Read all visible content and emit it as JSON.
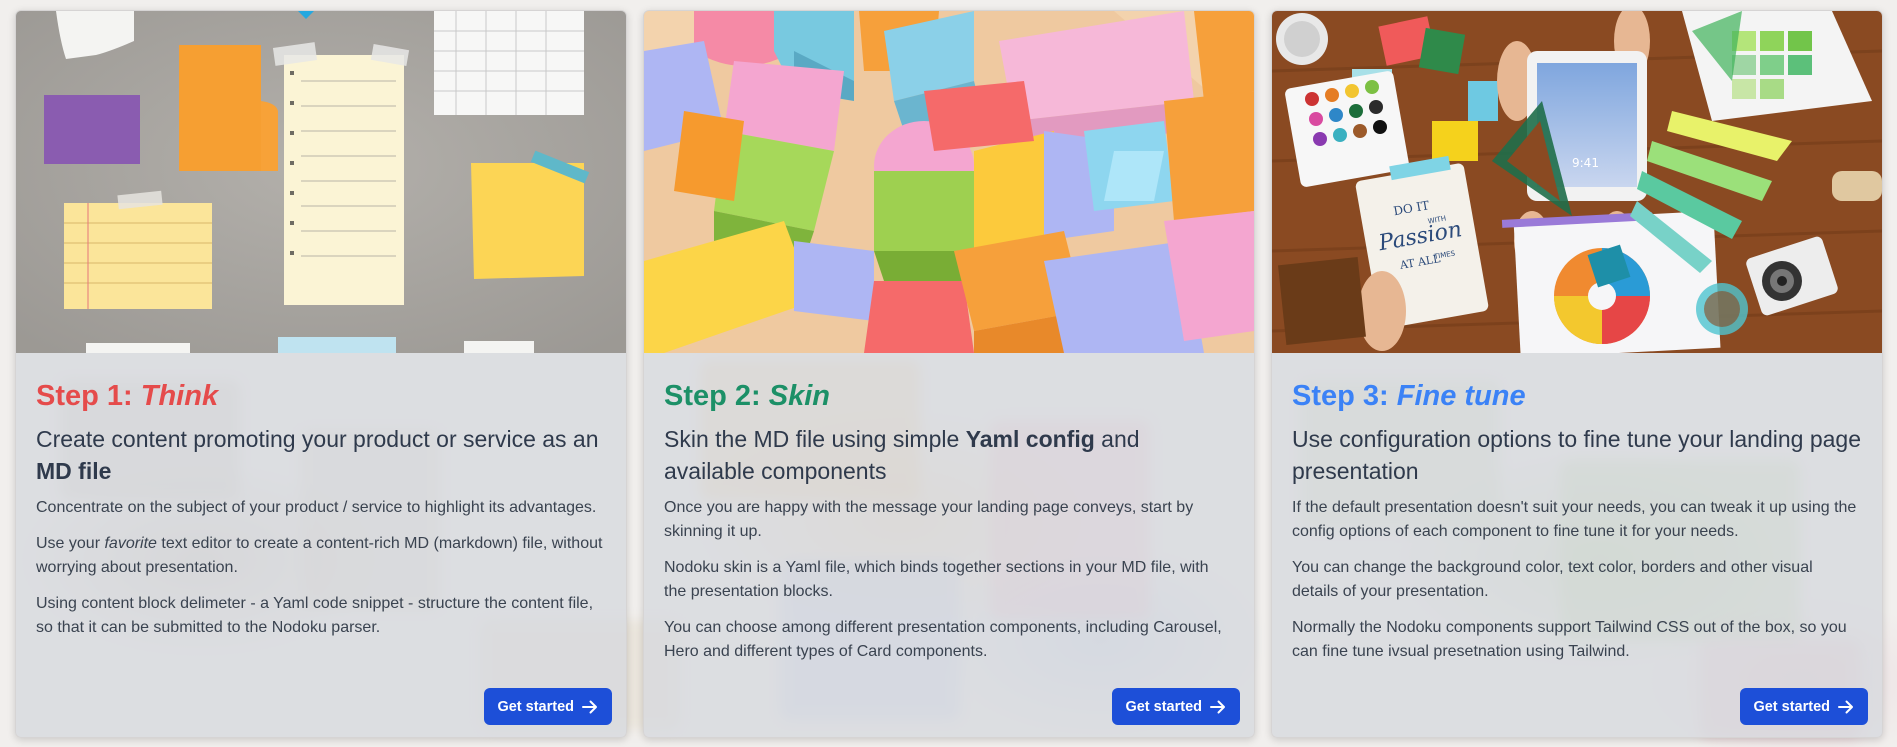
{
  "cards": [
    {
      "step_prefix": "Step 1: ",
      "step_word": "Think",
      "color": "#e54b4b",
      "subtitle_a": "Create content promoting your product or service as an ",
      "subtitle_b": "MD file",
      "subtitle_c": "",
      "paragraphs": [
        {
          "a": "Concentrate on the subject of your product / service to highlight its advantages.",
          "em": "",
          "b": ""
        },
        {
          "a": "Use your ",
          "em": "favorite",
          "b": " text editor to create a content-rich MD (markdown) file, without worrying about presentation."
        },
        {
          "a": "Using content block delimeter - a Yaml code snippet - structure the content file, so that it can be submitted to the Nodoku parser.",
          "em": "",
          "b": ""
        }
      ],
      "button": "Get started",
      "image_icon": "notes-paper-image"
    },
    {
      "step_prefix": "Step 2: ",
      "step_word": "Skin",
      "color": "#1c9067",
      "subtitle_a": "Skin the MD file using simple ",
      "subtitle_b": "Yaml config",
      "subtitle_c": " and available components",
      "paragraphs": [
        {
          "a": "Once you are happy with the message your landing page conveys, start by skinning it up.",
          "em": "",
          "b": ""
        },
        {
          "a": "Nodoku skin is a Yaml file, which binds together sections in your MD file, with the presentation blocks.",
          "em": "",
          "b": ""
        },
        {
          "a": "You can choose among different presentation components, including Carousel, Hero and different types of Card components.",
          "em": "",
          "b": ""
        }
      ],
      "button": "Get started",
      "image_icon": "colored-blocks-image"
    },
    {
      "step_prefix": "Step 3: ",
      "step_word": "Fine tune",
      "color": "#3b82f6",
      "subtitle_a": "Use configuration options to fine tune your landing page presentation",
      "subtitle_b": "",
      "subtitle_c": "",
      "paragraphs": [
        {
          "a": "If the default presentation doesn't suit your needs, you can tweak it up using the config options of each component to fine tune it for your needs.",
          "em": "",
          "b": ""
        },
        {
          "a": "You can change the background color, text color, borders and other visual details of your presentation.",
          "em": "",
          "b": ""
        },
        {
          "a": "Normally the Nodoku components support Tailwind CSS out of the box, so you can fine tune ivsual presetnation using Tailwind.",
          "em": "",
          "b": ""
        }
      ],
      "button": "Get started",
      "image_icon": "design-desk-image",
      "image_texts": {
        "lettering_1": "DO IT",
        "lettering_2": "Passion",
        "lettering_3": "WITH",
        "lettering_4": "AT ALL",
        "lettering_5": "TIMES",
        "tablet_time": "9:41"
      }
    }
  ]
}
